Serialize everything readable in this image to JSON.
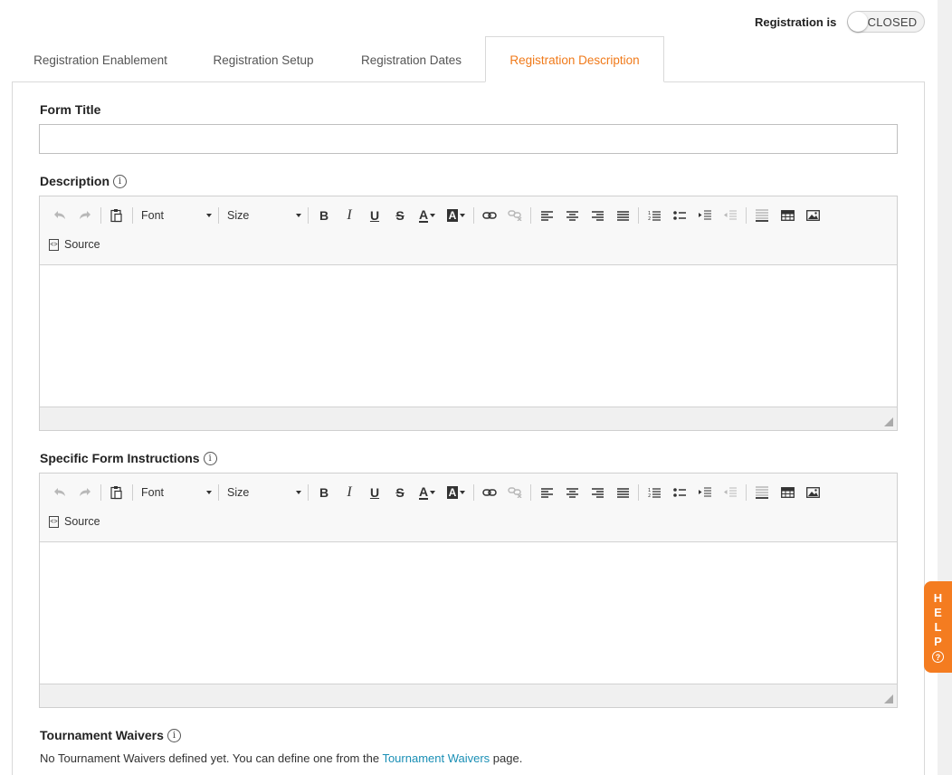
{
  "registration": {
    "label": "Registration is",
    "status": "CLOSED"
  },
  "tabs": [
    {
      "label": "Registration Enablement"
    },
    {
      "label": "Registration Setup"
    },
    {
      "label": "Registration Dates"
    },
    {
      "label": "Registration Description",
      "active": true
    }
  ],
  "form_title": {
    "label": "Form Title",
    "value": ""
  },
  "description": {
    "label": "Description",
    "info_icon": "i"
  },
  "instructions": {
    "label": "Specific Form Instructions",
    "info_icon": "i"
  },
  "toolbar": {
    "font_label": "Font",
    "size_label": "Size",
    "source_label": "Source",
    "bold": "B",
    "italic": "I",
    "underline": "U",
    "strike": "S",
    "text_color": "A",
    "bg_color": "A",
    "icons": [
      "undo-icon",
      "redo-icon",
      "paste-icon",
      "bold-icon",
      "italic-icon",
      "underline-icon",
      "strikethrough-icon",
      "text-color-icon",
      "background-color-icon",
      "link-icon",
      "unlink-icon",
      "align-left-icon",
      "align-center-icon",
      "align-right-icon",
      "align-justify-icon",
      "numbered-list-icon",
      "bulleted-list-icon",
      "indent-icon",
      "outdent-icon",
      "horizontal-rule-icon",
      "table-icon",
      "image-icon",
      "source-icon"
    ]
  },
  "waivers": {
    "label": "Tournament Waivers",
    "text_before": "No Tournament Waivers defined yet. You can define one from the ",
    "link": "Tournament Waivers",
    "text_after": " page."
  },
  "help": {
    "letters": [
      "H",
      "E",
      "L",
      "P"
    ],
    "icon": "?"
  },
  "colors": {
    "accent": "#f07a1a",
    "help_bg": "#f47c20",
    "link": "#1a8fb5"
  }
}
